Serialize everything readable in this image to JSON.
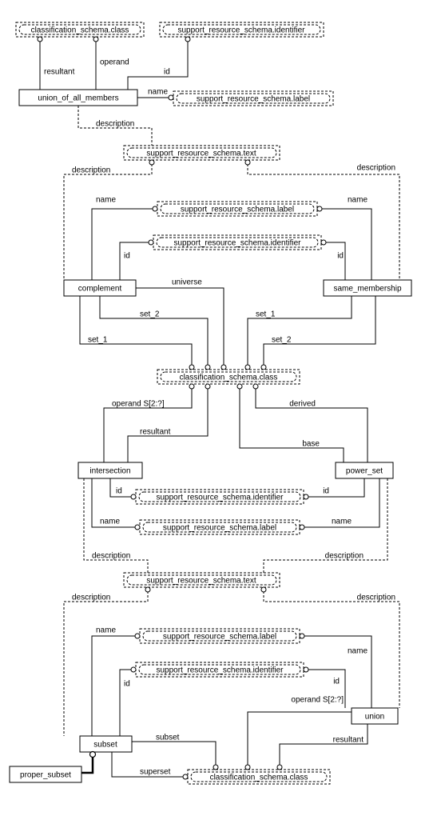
{
  "entities": {
    "union_of_all_members": "union_of_all_members",
    "complement": "complement",
    "same_membership": "same_membership",
    "intersection": "intersection",
    "power_set": "power_set",
    "subset": "subset",
    "proper_subset": "proper_subset",
    "union": "union"
  },
  "types": {
    "classification_schema_class": "classification_schema.class",
    "support_resource_schema_identifier": "support_resource_schema.identifier",
    "support_resource_schema_label": "support_resource_schema.label",
    "support_resource_schema_text": "support_resource_schema.text"
  },
  "attrs": {
    "resultant": "resultant",
    "operand": "operand",
    "id": "id",
    "name": "name",
    "description": "description",
    "universe": "universe",
    "set_1": "set_1",
    "set_2": "set_2",
    "derived": "derived",
    "base": "base",
    "operand_s": "operand S[2:?]",
    "subset": "subset",
    "superset": "superset"
  }
}
